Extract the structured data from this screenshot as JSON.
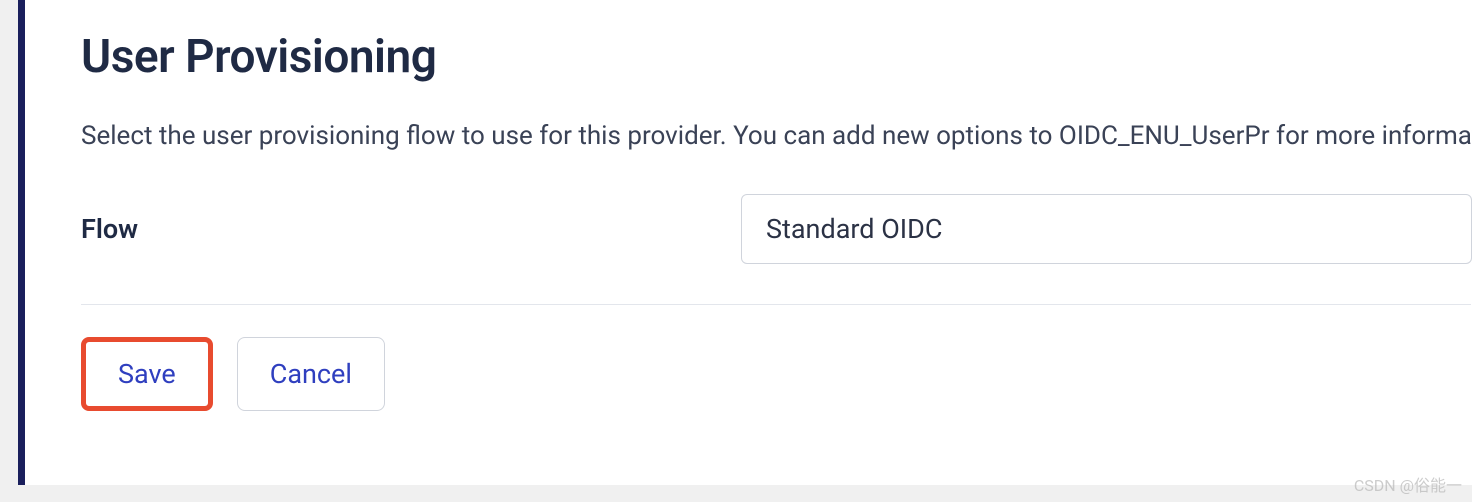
{
  "header": {
    "title": "User Provisioning"
  },
  "description": {
    "text": "Select the user provisioning flow to use for this provider. You can add new options to OIDC_ENU_UserPr for more information"
  },
  "form": {
    "flow": {
      "label": "Flow",
      "value": "Standard OIDC"
    }
  },
  "buttons": {
    "save": "Save",
    "cancel": "Cancel"
  },
  "watermark": "CSDN @俗能一"
}
